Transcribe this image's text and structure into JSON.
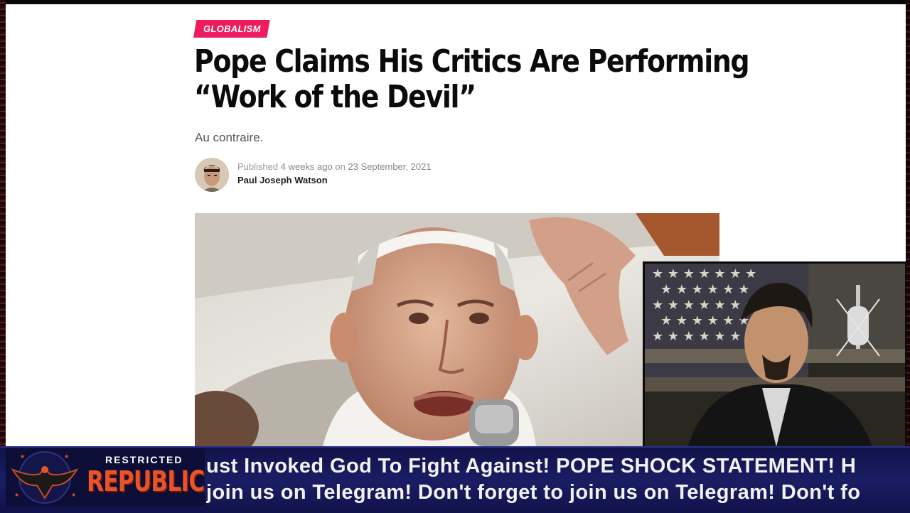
{
  "article": {
    "category": "GLOBALISM",
    "headline_line1": "Pope Claims His Critics Are Performing",
    "headline_line2": "“Work of the Devil”",
    "subtitle": "Au contraire.",
    "published_label": "Published",
    "published_relative": "4 weeks ago",
    "published_on": "on",
    "published_date": "23 September, 2021",
    "author": "Paul Joseph Watson"
  },
  "overlay": {
    "logo_top": "RESTRICTED",
    "logo_main": "REPUBLIC",
    "ticker_line1": "ust Invoked God To Fight Against! POPE SHOCK STATEMENT! H",
    "ticker_line2": " join us on Telegram!  Don't forget to join us on Telegram!  Don't fo"
  },
  "colors": {
    "category_tag": "#ec1c5e",
    "ticker_bg": "#1a1d63",
    "logo_orange": "#e8542a"
  }
}
